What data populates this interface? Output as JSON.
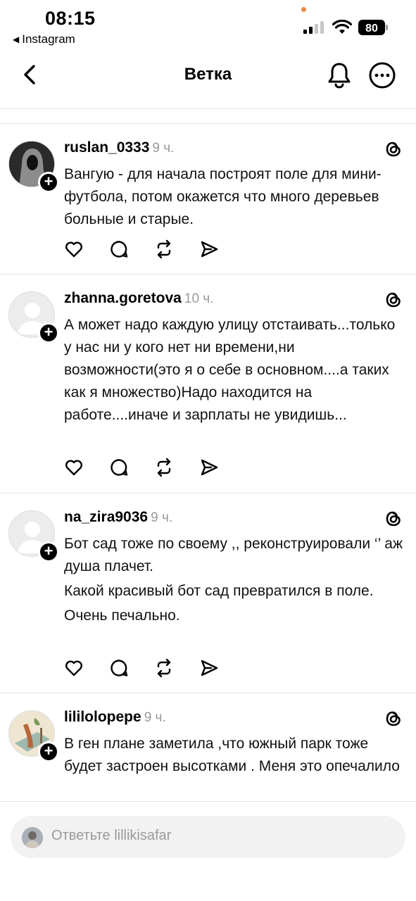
{
  "status": {
    "time": "08:15",
    "back_app": "Instagram",
    "battery": "80"
  },
  "header": {
    "title": "Ветка"
  },
  "comments": [
    {
      "username": "ruslan_0333",
      "time": "9 ч.",
      "text": [
        "Вангую - для начала построят поле для мини-футбола, потом окажется что много деревьев больные и старые."
      ]
    },
    {
      "username": "zhanna.goretova",
      "time": "10 ч.",
      "text": [
        "А может надо каждую улицу отстаивать...только у нас ни у кого нет ни времени,ни возможности(это я о себе в основном....а таких как я множество)Надо находится на работе....иначе и зарплаты не увидишь..."
      ]
    },
    {
      "username": "na_zira9036",
      "time": "9 ч.",
      "text": [
        "Бот сад тоже по своему ,, реконструировали ‘’ аж душа плачет.",
        "Какой красивый бот сад превратился в поле.",
        "Очень печально."
      ]
    },
    {
      "username": "lililolopepe",
      "time": "9 ч.",
      "text": [
        "В ген плане заметила ,что южный парк тоже будет застроен высотками . Меня это опечалило"
      ]
    }
  ],
  "reply": {
    "placeholder": "Ответьте lillikisafar"
  },
  "icons": {
    "back": "chevron-left-icon",
    "bell": "bell-icon",
    "more": "more-icon",
    "like": "heart-icon",
    "comment": "comment-icon",
    "repost": "repost-icon",
    "share": "send-icon",
    "threads": "threads-icon"
  }
}
